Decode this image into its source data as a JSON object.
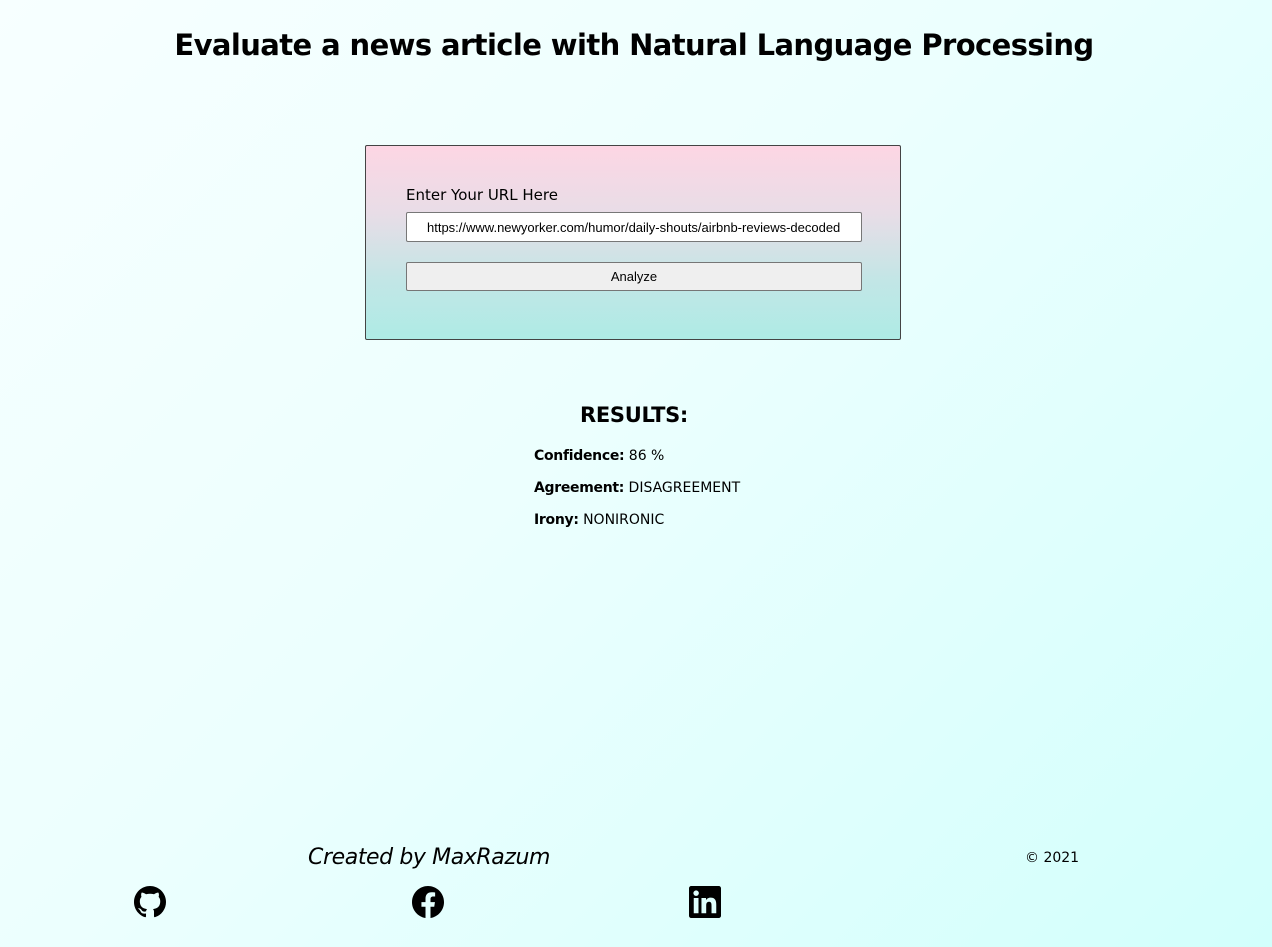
{
  "page": {
    "title": "Evaluate a news article with Natural Language Processing"
  },
  "form": {
    "label": "Enter Your URL Here",
    "url_value": "https://www.newyorker.com/humor/daily-shouts/airbnb-reviews-decoded",
    "submit_label": "Analyze"
  },
  "results": {
    "heading": "RESULTS:",
    "items": [
      {
        "key": "Confidence:",
        "value": "86 %"
      },
      {
        "key": "Agreement:",
        "value": "DISAGREEMENT"
      },
      {
        "key": "Irony:",
        "value": "NONIRONIC"
      }
    ]
  },
  "footer": {
    "credit": "Created by MaxRazum",
    "copyright": "© 2021",
    "social": [
      {
        "icon": "github-icon"
      },
      {
        "icon": "facebook-icon"
      },
      {
        "icon": "linkedin-icon"
      }
    ]
  },
  "colors": {
    "text": "#000000",
    "card_top": "#fdd6e4",
    "card_bottom": "#aeebe5",
    "background_start": "#f7ffff",
    "background_end": "#d2fffc",
    "button_bg": "#efefef"
  }
}
